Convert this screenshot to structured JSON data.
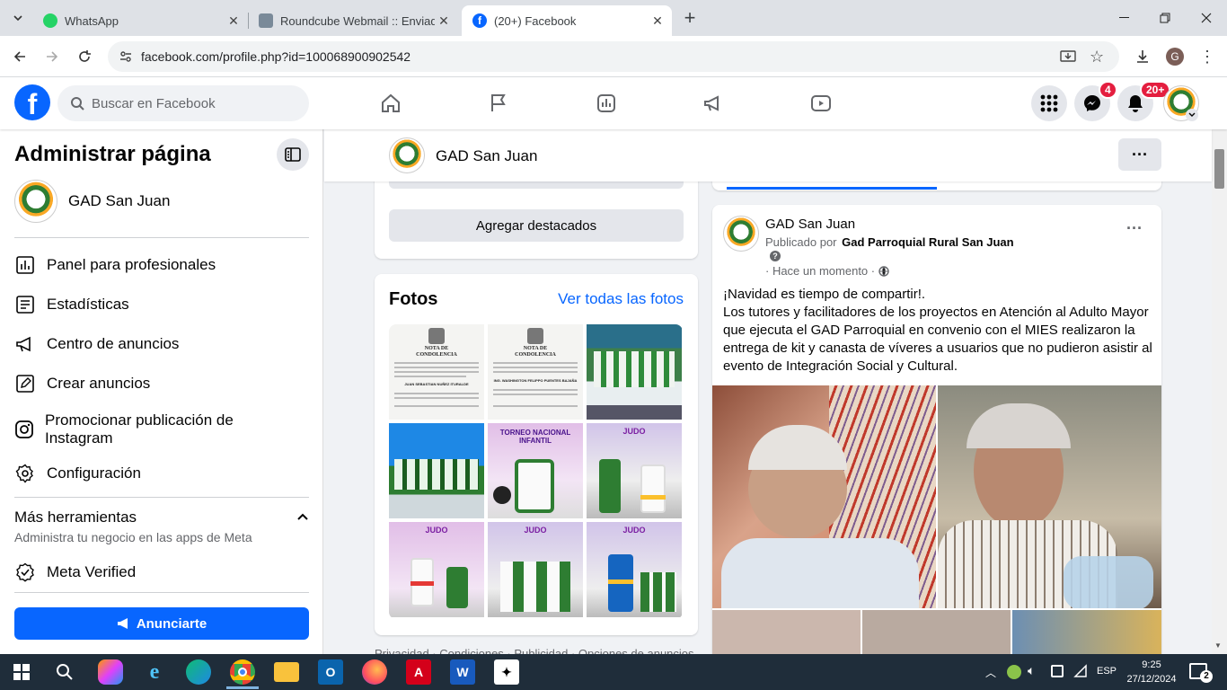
{
  "browser": {
    "tabs": [
      {
        "title": "WhatsApp"
      },
      {
        "title": "Roundcube Webmail :: Enviados"
      },
      {
        "title": "(20+) Facebook"
      }
    ],
    "url": "facebook.com/profile.php?id=100068900902542",
    "profile_initial": "G"
  },
  "fb": {
    "search_placeholder": "Buscar en Facebook",
    "messenger_badge": "4",
    "notif_badge": "20+"
  },
  "sidebar": {
    "title": "Administrar página",
    "page_name": "GAD San Juan",
    "items": [
      {
        "label": "Panel para profesionales",
        "icon": "dashboard-icon"
      },
      {
        "label": "Estadísticas",
        "icon": "insights-icon"
      },
      {
        "label": "Centro de anuncios",
        "icon": "megaphone-icon"
      },
      {
        "label": "Crear anuncios",
        "icon": "pencil-icon"
      },
      {
        "label": "Promocionar publicación de Instagram",
        "icon": "instagram-icon"
      },
      {
        "label": "Configuración",
        "icon": "gear-icon"
      }
    ],
    "more_tools_title": "Más herramientas",
    "more_tools_sub": "Administra tu negocio en las apps de Meta",
    "meta_verified": "Meta Verified",
    "ad_button": "Anunciarte"
  },
  "pagebar": {
    "name": "GAD San Juan"
  },
  "highlights": {
    "button": "Agregar destacados"
  },
  "photos": {
    "title": "Fotos",
    "see_all": "Ver todas las fotos",
    "doc_line1": "NOTA DE",
    "doc_line2": "CONDOLENCIA",
    "doc1_name": "JUAN SEBASTIAN NUÑEZ ITURALDE",
    "doc2_name": "ING. WASHINGTON FELIPPO PUENTES BAJAÑA",
    "banner_text": "TORNEO NACIONAL INFANTIL",
    "judo_text": "JUDO"
  },
  "footer_links": "Privacidad · Condiciones · Publicidad · Opciones de anuncios",
  "post": {
    "author": "GAD San Juan",
    "published_by_prefix": "Publicado por",
    "published_by": "Gad Parroquial Rural San Juan",
    "time": "· Hace un momento ·",
    "text_line1": "¡Navidad es tiempo de compartir!.",
    "text_body": "Los tutores y facilitadores de los proyectos en Atención al Adulto Mayor que ejecuta el GAD Parroquial en convenio con el MIES realizaron la entrega de kit y canasta de víveres a usuarios que no pudieron asistir al evento de Integración Social y Cultural."
  },
  "taskbar": {
    "lang": "ESP",
    "time": "9:25",
    "date": "27/12/2024",
    "notif_count": "2"
  }
}
